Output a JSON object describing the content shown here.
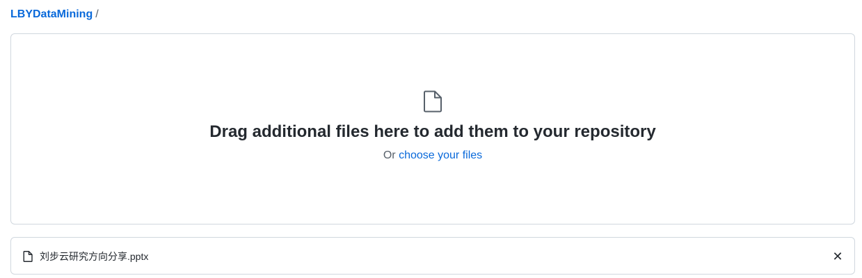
{
  "breadcrumb": {
    "repo": "LBYDataMining",
    "separator": "/"
  },
  "dropzone": {
    "icon": "file-icon",
    "title": "Drag additional files here to add them to your repository",
    "or_text": "Or",
    "choose_link": "choose your files"
  },
  "upload_list": {
    "files": [
      {
        "name": "刘步云研究方向分享.pptx",
        "icon": "file-icon",
        "remove_icon": "close-icon"
      }
    ]
  },
  "colors": {
    "link": "#0969da",
    "text": "#24292f",
    "muted": "#57606a",
    "border": "#d0d7de"
  }
}
